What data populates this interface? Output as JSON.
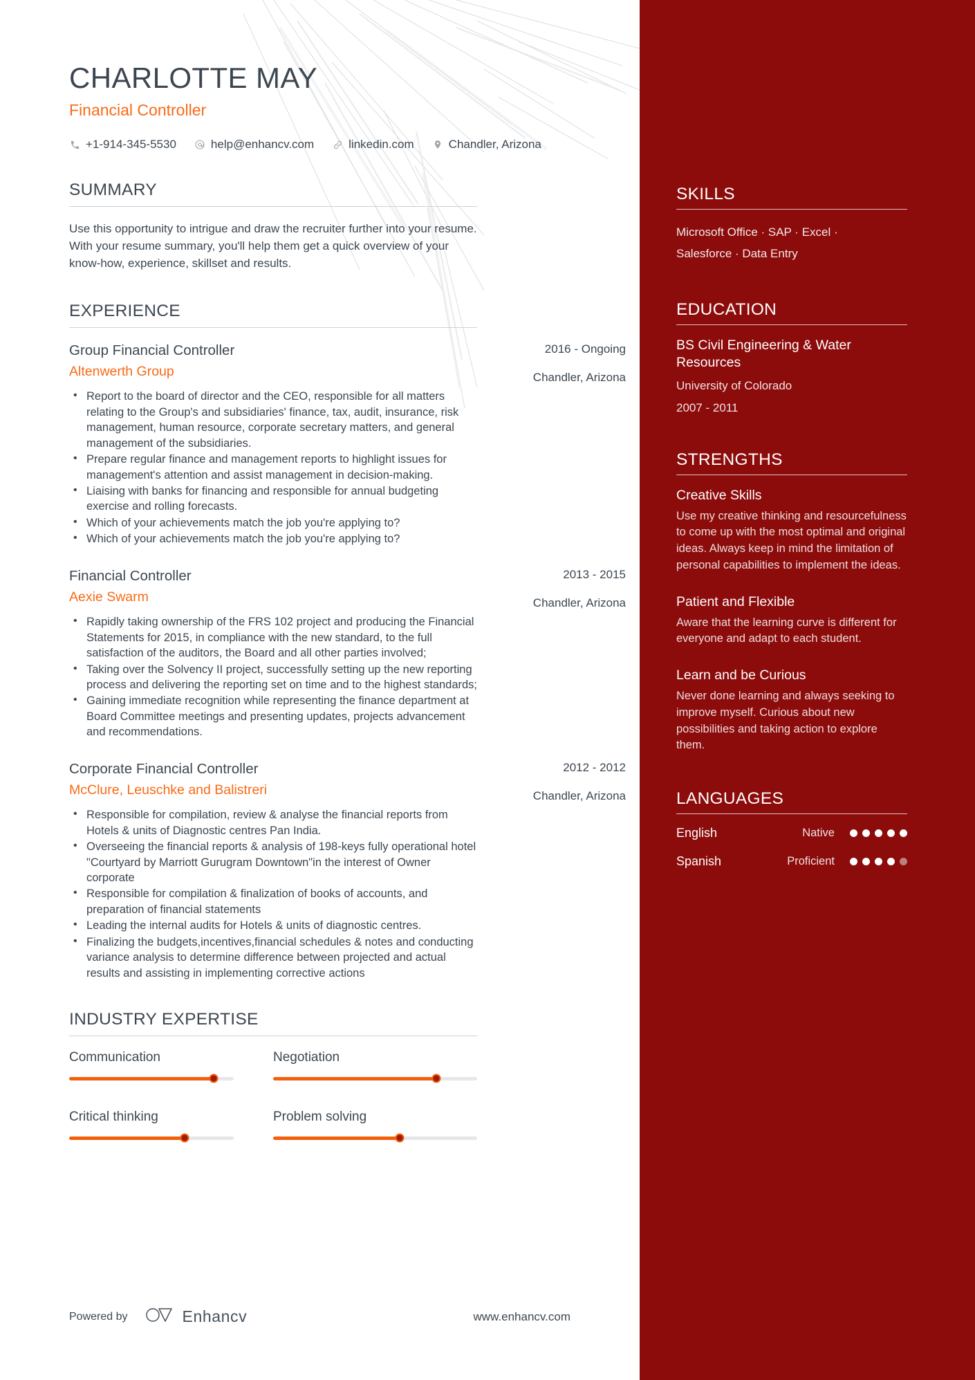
{
  "header": {
    "name": "CHARLOTTE MAY",
    "job_title": "Financial Controller",
    "accent_color": "#f96a16",
    "contacts": [
      {
        "icon": "phone-icon",
        "text": "+1-914-345-5530"
      },
      {
        "icon": "email-icon",
        "text": "help@enhancv.com"
      },
      {
        "icon": "link-icon",
        "text": "linkedin.com"
      },
      {
        "icon": "location-pin-icon",
        "text": "Chandler, Arizona"
      }
    ]
  },
  "summary": {
    "title": "SUMMARY",
    "text": "Use this opportunity to intrigue and draw the recruiter further into your resume. With your resume summary, you'll help them get a quick overview of your know-how, experience, skillset and results."
  },
  "experience": {
    "title": "EXPERIENCE",
    "items": [
      {
        "role": "Group Financial Controller",
        "company": "Altenwerth Group",
        "date": "2016 - Ongoing",
        "location": "Chandler, Arizona",
        "bullets": [
          "Report to the board of director and the CEO, responsible for all matters relating to the Group's and subsidiaries' finance, tax, audit, insurance, risk management, human resource, corporate secretary matters, and general management of the subsidiaries.",
          "Prepare regular finance and management reports to highlight issues for management's attention and assist management in decision-making.",
          "Liaising with banks for financing and responsible for annual budgeting exercise and rolling forecasts.",
          "Which of your achievements match the job you're applying to?",
          "Which of your achievements match the job you're applying to?"
        ]
      },
      {
        "role": "Financial Controller",
        "company": "Aexie Swarm",
        "date": "2013 - 2015",
        "location": "Chandler, Arizona",
        "bullets": [
          "Rapidly taking ownership of the FRS 102 project and producing the Financial Statements for 2015, in compliance with the new standard, to the full satisfaction of the auditors, the Board and all other parties involved;",
          "Taking over the Solvency II project, successfully setting up the new reporting process and delivering the reporting set on time and to the highest standards;",
          "Gaining immediate recognition while representing the finance department at Board Committee meetings and presenting updates, projects advancement and recommendations."
        ]
      },
      {
        "role": "Corporate Financial Controller",
        "company": "McClure, Leuschke and Balistreri",
        "date": "2012 - 2012",
        "location": "Chandler, Arizona",
        "bullets": [
          "Responsible for compilation, review & analyse the financial reports from Hotels & units of Diagnostic centres Pan India.",
          "Overseeing the financial reports & analysis of 198-keys fully operational hotel \"Courtyard by Marriott Gurugram Downtown\"in the interest of Owner corporate",
          "Responsible for compilation & finalization of books of accounts, and preparation of financial statements",
          "Leading the internal audits for Hotels & units of diagnostic centres.",
          "Finalizing the budgets,incentives,financial schedules & notes and conducting variance analysis to determine difference between projected and actual results and assisting in implementing corrective actions"
        ]
      }
    ]
  },
  "industry_expertise": {
    "title": "INDUSTRY EXPERTISE",
    "items": [
      {
        "label": "Communication",
        "value": 88
      },
      {
        "label": "Negotiation",
        "value": 80
      },
      {
        "label": "Critical thinking",
        "value": 70
      },
      {
        "label": "Problem solving",
        "value": 62
      }
    ]
  },
  "sidebar": {
    "background_color": "#8c0b0b",
    "skills": {
      "title": "SKILLS",
      "lines": [
        "Microsoft Office · SAP · Excel ·",
        "Salesforce · Data Entry"
      ]
    },
    "education": {
      "title": "EDUCATION",
      "degree": "BS Civil Engineering & Water Resources",
      "school": "University of Colorado",
      "date": "2007 - 2011"
    },
    "strengths": {
      "title": "STRENGTHS",
      "items": [
        {
          "name": "Creative Skills",
          "text": "Use my creative thinking and resourcefulness to come up with the most optimal and original ideas. Always keep in mind the limitation of personal capabilities to implement the ideas."
        },
        {
          "name": "Patient and Flexible",
          "text": "Aware that the learning curve is different for everyone and adapt to each student."
        },
        {
          "name": "Learn and be Curious",
          "text": "Never done learning and always seeking to improve myself. Curious about new possibilities and taking action to explore them."
        }
      ]
    },
    "languages": {
      "title": "LANGUAGES",
      "items": [
        {
          "name": "English",
          "level": "Native",
          "dots_filled": 5,
          "dots_total": 5
        },
        {
          "name": "Spanish",
          "level": "Proficient",
          "dots_filled": 4,
          "dots_total": 5
        }
      ]
    }
  },
  "footer": {
    "powered_by": "Powered by",
    "brand": "Enhancv",
    "site": "www.enhancv.com"
  }
}
